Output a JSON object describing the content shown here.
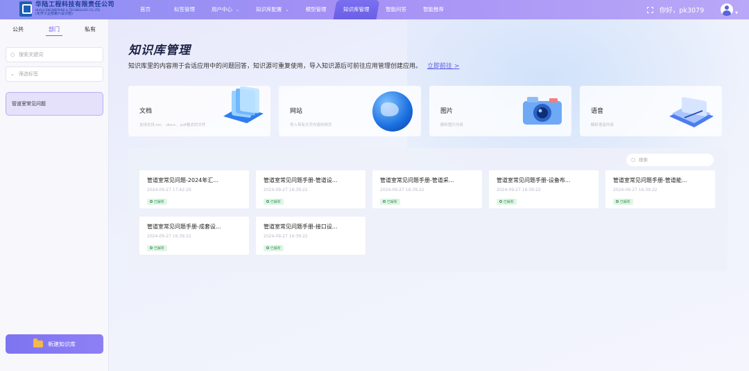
{
  "header": {
    "logo_cn": "华陆工程科技有限责任公司",
    "logo_en": "HUALU ENGINEERING & TECHNOLOGY CO.,LTD.",
    "logo_sub": "(化学工业部第六设计院)",
    "nav": [
      {
        "label": "首页"
      },
      {
        "label": "标签管理"
      },
      {
        "label": "用户中心",
        "has_dropdown": true
      },
      {
        "label": "知识库配置",
        "has_dropdown": true
      },
      {
        "label": "模型管理"
      },
      {
        "label": "知识库管理",
        "active": true
      },
      {
        "label": "智能问答"
      },
      {
        "label": "智能推荐"
      }
    ],
    "greeting": "你好，pk3079"
  },
  "sidebar": {
    "tabs": [
      {
        "label": "公共"
      },
      {
        "label": "部门",
        "active": true
      },
      {
        "label": "私有"
      }
    ],
    "search_placeholder": "搜索关键词",
    "filter_placeholder": "筛选标签",
    "items": [
      {
        "label": "管道室常见问题",
        "selected": true
      }
    ],
    "new_button": "新建知识库"
  },
  "main": {
    "title": "知识库管理",
    "description": "知识库里的内容用于会话应用中的问题回答，知识源可重复使用，导入知识源后可前往应用管理创建应用。",
    "link": "立即前往 >",
    "types": [
      {
        "title": "文档",
        "subtitle": "支持支持.txt、.docx、.pdf格式的文件",
        "icon": "document-stack-icon"
      },
      {
        "title": "网站",
        "subtitle": "导入带有文字内容的网页",
        "icon": "globe-icon"
      },
      {
        "title": "图片",
        "subtitle": "解析图片内容",
        "icon": "camera-icon"
      },
      {
        "title": "语音",
        "subtitle": "解析语音内容",
        "icon": "keyboard-icon"
      }
    ],
    "panel_search_placeholder": "搜索",
    "cards": [
      {
        "title": "管道室常见问题-2024年汇...",
        "time": "2024-09-27 17:42:29",
        "status": "已解析"
      },
      {
        "title": "管道室常见问题手册-管道设...",
        "time": "2024-09-27 16:39:22",
        "status": "已解析"
      },
      {
        "title": "管道室常见问题手册-管道采...",
        "time": "2024-09-27 16:39:22",
        "status": "已解析"
      },
      {
        "title": "管道室常见问题手册-设备布...",
        "time": "2024-09-27 16:39:22",
        "status": "已解析"
      },
      {
        "title": "管道室常见问题手册-管道能...",
        "time": "2024-09-27 16:39:22",
        "status": "已解析"
      },
      {
        "title": "管道室常见问题手册-成套设...",
        "time": "2024-09-27 16:39:22",
        "status": "已解析"
      },
      {
        "title": "管道室常见问题手册-接口设...",
        "time": "2024-09-27 16:39:22",
        "status": "已解析"
      }
    ]
  },
  "colors": {
    "accent": "#6d63ec",
    "topbar_start": "#8b8ff3",
    "topbar_end": "#b9a8f7",
    "status_green": "#3a9a58"
  }
}
